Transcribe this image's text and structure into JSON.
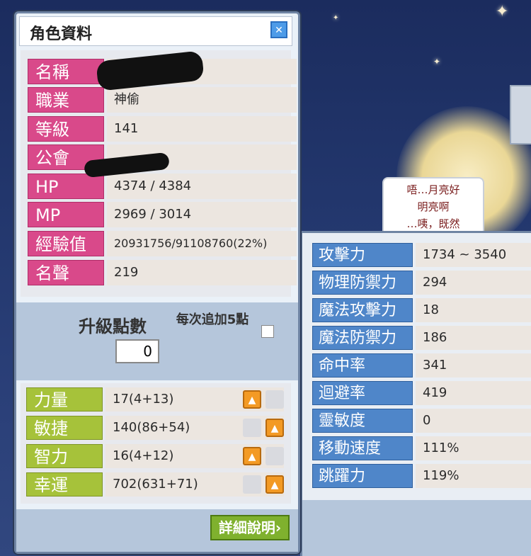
{
  "window": {
    "title": "角色資料"
  },
  "info": [
    {
      "label": "名稱",
      "value": ""
    },
    {
      "label": "職業",
      "value": "神偷"
    },
    {
      "label": "等級",
      "value": "141"
    },
    {
      "label": "公會",
      "value": ""
    },
    {
      "label": "HP",
      "value": "4374 / 4384"
    },
    {
      "label": "MP",
      "value": "2969 / 3014"
    },
    {
      "label": "經驗值",
      "value": "20931756/91108760(22%)"
    },
    {
      "label": "名聲",
      "value": "219"
    }
  ],
  "ability_points": {
    "label": "升級點數",
    "value": "0",
    "auto_label": "每次追加5點",
    "auto_checked": false
  },
  "stats": [
    {
      "label": "力量",
      "value": "17(4+13)"
    },
    {
      "label": "敏捷",
      "value": "140(86+54)"
    },
    {
      "label": "智力",
      "value": "16(4+12)"
    },
    {
      "label": "幸運",
      "value": "702(631+71)"
    }
  ],
  "detail_button": "詳細說明",
  "speech": [
    "唔…月亮好",
    "明亮啊",
    "…咦，既然"
  ],
  "detail_stats": [
    {
      "label": "攻擊力",
      "value": "1734 ~ 3540"
    },
    {
      "label": "物理防禦力",
      "value": "294"
    },
    {
      "label": "魔法攻擊力",
      "value": "18"
    },
    {
      "label": "魔法防禦力",
      "value": "186"
    },
    {
      "label": "命中率",
      "value": "341"
    },
    {
      "label": "迴避率",
      "value": "419"
    },
    {
      "label": "靈敏度",
      "value": "0"
    },
    {
      "label": "移動速度",
      "value": "111%"
    },
    {
      "label": "跳躍力",
      "value": "119%"
    }
  ],
  "colors": {
    "info_label": "#d9498a",
    "stat_label": "#a6c23a",
    "detail_label": "#4f86c9",
    "up_button": "#f39a24"
  },
  "icons": {
    "close": "close-icon",
    "up": "up-arrow-icon",
    "detail": "chevron-right-icon"
  }
}
